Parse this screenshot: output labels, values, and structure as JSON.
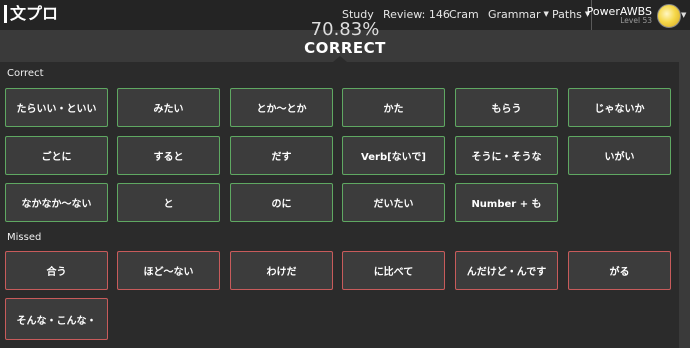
{
  "nav": {
    "logo": "文プロ",
    "links": [
      "Study",
      "Review: 146",
      "Cram",
      "Grammar",
      "Paths"
    ],
    "user_name": "PowerAWBS",
    "user_level": "Level 53"
  },
  "score": {
    "percent": "70.83%",
    "title": "CORRECT"
  },
  "correct": {
    "label": "Correct",
    "items": [
      "たらいい・といい",
      "みたい",
      "とか〜とか",
      "かた",
      "もらう",
      "じゃないか",
      "ごとに",
      "すると",
      "だす",
      "Verb[ないで]",
      "そうに・そうな",
      "いがい",
      "なかなか〜ない",
      "と",
      "のに",
      "だいたい",
      "Number + も"
    ]
  },
  "missed": {
    "label": "Missed",
    "items": [
      "合う",
      "ほど〜ない",
      "わけだ",
      "に比べて",
      "んだけど・んです",
      "がる",
      "そんな・こんな・"
    ]
  },
  "colors": {
    "correct_border": "#5fa862",
    "missed_border": "#c85b5b",
    "nav_bg": "#242424",
    "panel_bg": "#2b2b2b"
  }
}
